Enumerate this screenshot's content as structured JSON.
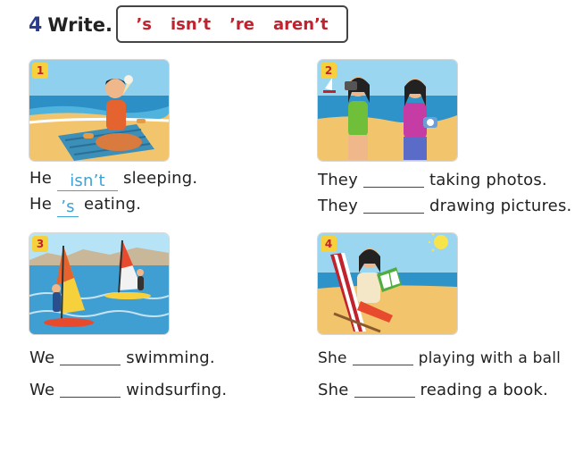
{
  "exercise": {
    "number": "4",
    "title": "Write."
  },
  "word_box": [
    "’s",
    "isn’t",
    "’re",
    "aren’t"
  ],
  "items": [
    {
      "badge": "1",
      "sentences": [
        {
          "subject": "He",
          "answer": "isn’t",
          "rest": "sleeping."
        },
        {
          "subject": "He",
          "answer": "’s",
          "rest": "eating."
        }
      ]
    },
    {
      "badge": "2",
      "sentences": [
        {
          "subject": "They",
          "answer": "",
          "rest": "taking photos."
        },
        {
          "subject": "They",
          "answer": "",
          "rest": "drawing pictures."
        }
      ]
    },
    {
      "badge": "3",
      "sentences": [
        {
          "subject": "We",
          "answer": "",
          "rest": "swimming."
        },
        {
          "subject": "We",
          "answer": "",
          "rest": "windsurfing."
        }
      ]
    },
    {
      "badge": "4",
      "sentences": [
        {
          "subject": "She",
          "answer": "",
          "rest": "playing with a ball"
        },
        {
          "subject": "She",
          "answer": "",
          "rest": "reading a book."
        }
      ]
    }
  ]
}
